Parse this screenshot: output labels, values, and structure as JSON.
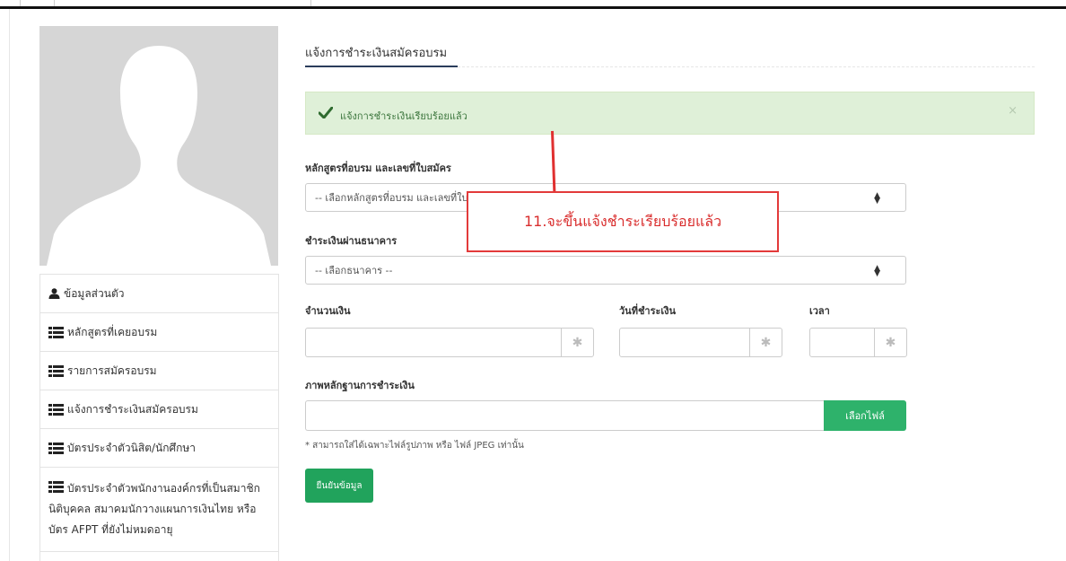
{
  "sidebar": {
    "items": [
      {
        "label": "ข้อมูลส่วนตัว",
        "icon": "user-icon"
      },
      {
        "label": "หลักสูตรที่เคยอบรม",
        "icon": "list-icon"
      },
      {
        "label": "รายการสมัครอบรม",
        "icon": "list-icon"
      },
      {
        "label": "แจ้งการชำระเงินสมัครอบรม",
        "icon": "list-icon"
      },
      {
        "label": "บัตรประจำตัวนิสิต/นักศึกษา",
        "icon": "list-icon"
      },
      {
        "label": "บัตรประจำตัวพนักงานองค์กรที่เป็นสมาชิกนิติบุคคล สมาคมนักวางแผนการเงินไทย หรือบัตร AFPT ที่ยังไม่หมดอายุ",
        "icon": "list-icon"
      }
    ]
  },
  "main": {
    "title": "แจ้งการชำระเงินสมัครอบรม",
    "alert": {
      "message": "แจ้งการชำระเงินเรียบร้อยแล้ว",
      "close": "×"
    },
    "course": {
      "label": "หลักสูตรที่อบรม และเลขที่ใบสมัคร",
      "placeholder": "-- เลือกหลักสูตรที่อบรม และเลขที่ใบสมัคร --"
    },
    "bank": {
      "label": "ชำระเงินผ่านธนาคาร",
      "placeholder": "-- เลือกธนาคาร --"
    },
    "amount": {
      "label": "จำนวนเงิน",
      "value": ""
    },
    "pay_date": {
      "label": "วันที่ชำระเงิน",
      "value": ""
    },
    "pay_time": {
      "label": "เวลา",
      "value": ""
    },
    "evidence": {
      "label": "ภาพหลักฐานการชำระเงิน",
      "button": "เลือกไฟล์",
      "note": "* สามารถใส่ได้เฉพาะไฟล์รูปภาพ หรือ ไฟล์ JPEG เท่านั้น"
    },
    "submit": "ยืนยันข้อมูล"
  },
  "annotation": {
    "text": "11.จะขึ้นแจ้งชำระเรียบร้อยแล้ว"
  },
  "colors": {
    "accent_green": "#21a35c",
    "alert_bg": "#dff0d8",
    "annotation_red": "#e03030",
    "title_underline": "#2a3d5c"
  }
}
